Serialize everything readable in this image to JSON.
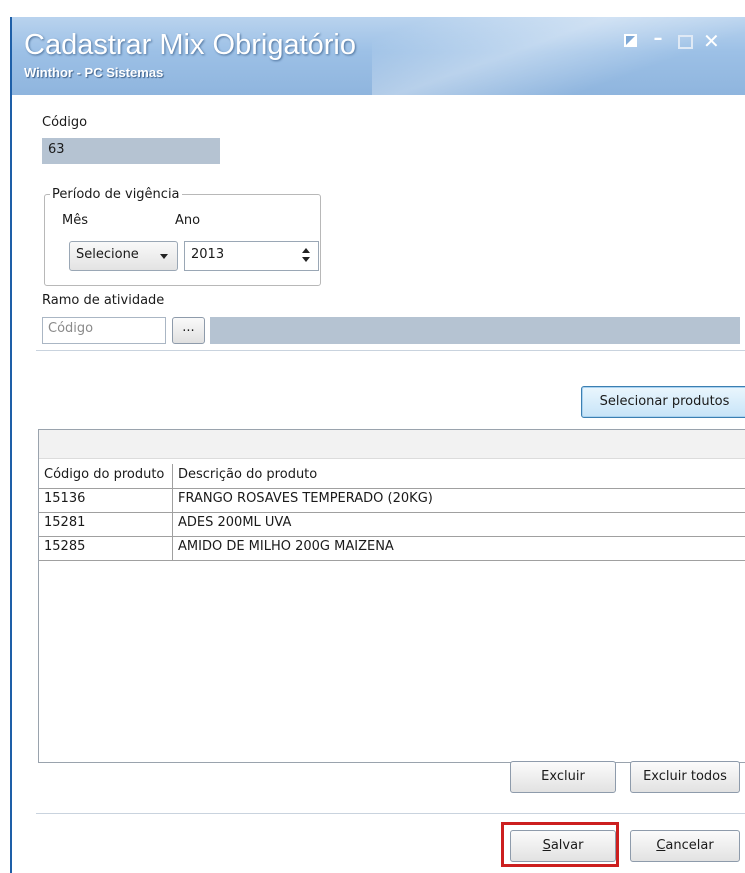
{
  "window": {
    "title": "Cadastrar Mix Obrigatório",
    "subtitle": "Winthor - PC Sistemas",
    "controls": [
      "restore-icon",
      "minimize-icon",
      "maximize-icon",
      "close-icon"
    ]
  },
  "form": {
    "codigo_label": "Código",
    "codigo_value": "63",
    "periodo_label": "Período de vigência",
    "mes_label": "Mês",
    "mes_value": "Selecione",
    "ano_label": "Ano",
    "ano_value": "2013",
    "ramo_label": "Ramo de atividade",
    "ramo_codigo_placeholder": "Código",
    "ramo_lookup_label": "...",
    "ramo_descricao_value": ""
  },
  "products": {
    "select_button": "Selecionar produtos",
    "columns": [
      "Código do produto",
      "Descrição do produto"
    ],
    "rows": [
      {
        "codigo": "15136",
        "descricao": "FRANGO ROSAVES TEMPERADO (20KG)"
      },
      {
        "codigo": "15281",
        "descricao": "ADES 200ML UVA"
      },
      {
        "codigo": "15285",
        "descricao": "AMIDO DE MILHO 200G MAIZENA"
      }
    ],
    "excluir_label": "Excluir",
    "excluir_todos_label": "Excluir todos"
  },
  "footer": {
    "salvar_key": "S",
    "salvar_rest": "alvar",
    "cancelar_key": "C",
    "cancelar_rest": "ancelar"
  },
  "colors": {
    "titlebar": "#9cc0e6",
    "readonly_field": "#b5c3d2",
    "highlight": "#cc1f1f",
    "window_border": "#1e5fa8"
  }
}
